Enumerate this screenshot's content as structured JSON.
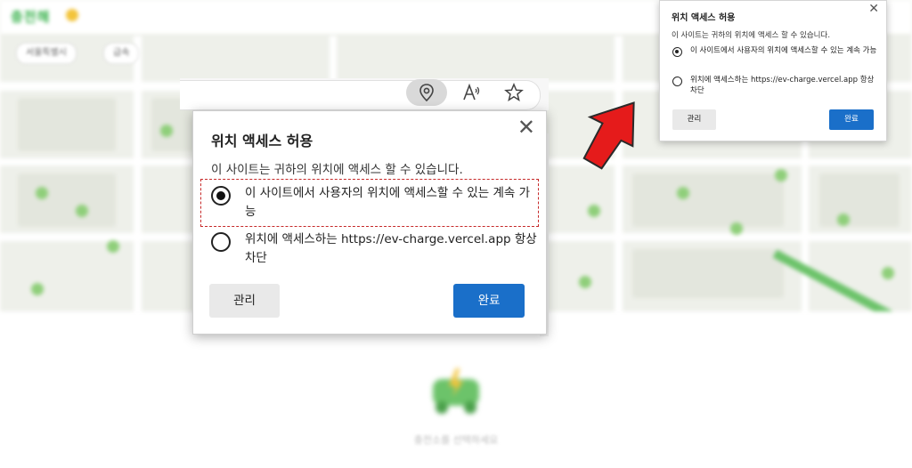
{
  "brand": {
    "logo_text": "충전해"
  },
  "filters": [
    "서울특별시",
    "급속"
  ],
  "mini_popup": {
    "title": "위치 액세스 허용",
    "subtitle": "이 사이트는 귀하의 위치에 액세스 할 수 있습니다.",
    "option_allow": "이 사이트에서 사용자의 위치에 액세스할 수 있는 계속 가능",
    "option_block": "위치에 액세스하는 https://ev-charge.vercel.app 항상 차단",
    "manage_label": "관리",
    "done_label": "완료",
    "close_glyph": "✕"
  },
  "zoom_popup": {
    "title": "위치 액세스 허용",
    "subtitle": "이 사이트는 귀하의 위치에 액세스 할 수 있습니다.",
    "option_allow": "이 사이트에서 사용자의 위치에 액세스할 수 있는 계속 가능",
    "option_block": "위치에 액세스하는 https://ev-charge.vercel.app 항상 차단",
    "manage_label": "관리",
    "done_label": "완료",
    "close_glyph": "✕",
    "selected_option": "allow"
  },
  "addressbar_icons": [
    "location-icon",
    "read-aloud-icon",
    "favorite-star-icon"
  ],
  "footer": {
    "caption": "충전소를 선택하세요"
  },
  "colors": {
    "primary_button": "#1a6fc9",
    "highlight_border": "#c62828",
    "arrow": "#e51b1b",
    "brand_green": "#36b14a"
  }
}
